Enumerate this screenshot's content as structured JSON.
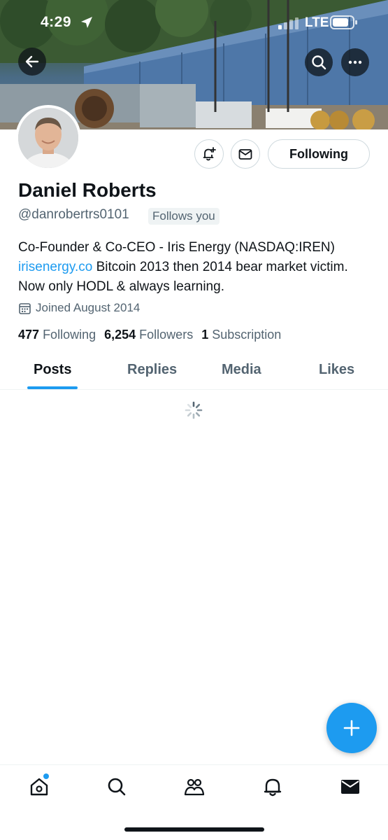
{
  "status_bar": {
    "time": "4:29",
    "network": "LTE",
    "icons": [
      "location-arrow-icon",
      "signal-icon",
      "battery-icon"
    ]
  },
  "profile": {
    "name": "Daniel Roberts",
    "handle": "@danrobertrs0101",
    "follows_you": "Follows you",
    "bio_text_1": "Co-Founder & Co-CEO - Iris Energy (NASDAQ:IREN) ",
    "bio_link": "irisenergy.co",
    "bio_text_2": " Bitcoin 2013 then 2014 bear market victim. Now only HODL & always learning.",
    "joined": "Joined August 2014",
    "stats": {
      "following_count": "477",
      "following_label": "Following",
      "followers_count": "6,254",
      "followers_label": "Followers",
      "subscriptions_count": "1",
      "subscriptions_label": "Subscription"
    }
  },
  "actions": {
    "following_label": "Following",
    "notify_icon": "bell-plus-icon",
    "message_icon": "envelope-icon"
  },
  "tabs": [
    {
      "label": "Posts",
      "active": true
    },
    {
      "label": "Replies",
      "active": false
    },
    {
      "label": "Media",
      "active": false
    },
    {
      "label": "Likes",
      "active": false
    }
  ],
  "bottom_nav": [
    "home-icon",
    "search-icon",
    "communities-icon",
    "notifications-icon",
    "messages-icon"
  ],
  "colors": {
    "accent": "#1d9bf0",
    "text_primary": "#0f1419",
    "text_secondary": "#536471",
    "border": "#cfd9de"
  }
}
